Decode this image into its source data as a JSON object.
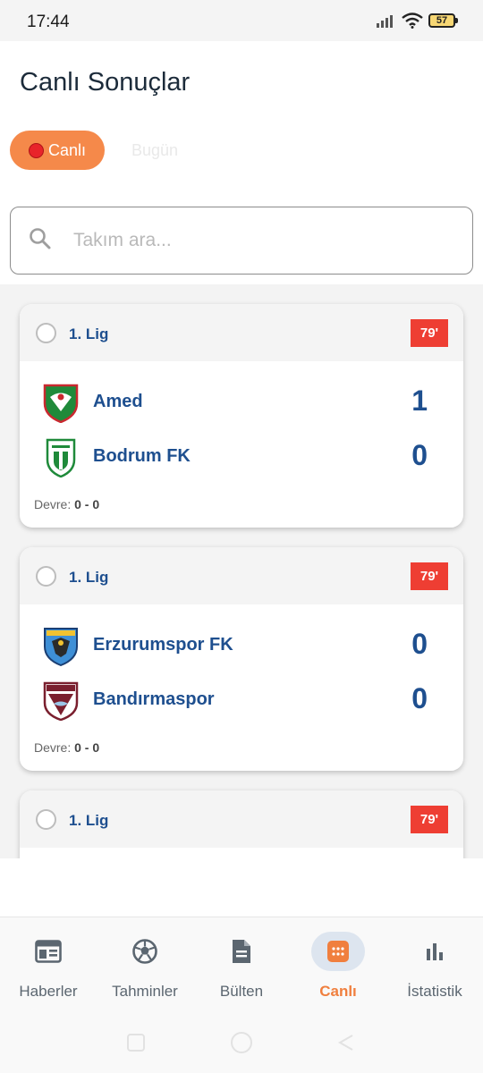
{
  "status_bar": {
    "time": "17:44",
    "battery": "57"
  },
  "page_title": "Canlı Sonuçlar",
  "tabs": [
    {
      "label": "Canlı",
      "active": true
    },
    {
      "label": "Bugün",
      "active": false
    }
  ],
  "search": {
    "placeholder": "Takım ara...",
    "value": ""
  },
  "matches": [
    {
      "league": "1. Lig",
      "minute": "79'",
      "home": {
        "name": "Amed",
        "score": "1"
      },
      "away": {
        "name": "Bodrum FK",
        "score": "0"
      },
      "halftime_label": "Devre:",
      "halftime_score": "0 - 0"
    },
    {
      "league": "1. Lig",
      "minute": "79'",
      "home": {
        "name": "Erzurumspor FK",
        "score": "0"
      },
      "away": {
        "name": "Bandırmaspor",
        "score": "0"
      },
      "halftime_label": "Devre:",
      "halftime_score": "0 - 0"
    },
    {
      "league": "1. Lig",
      "minute": "79'"
    }
  ],
  "bottom_nav": [
    {
      "label": "Haberler",
      "icon": "news-icon",
      "active": false
    },
    {
      "label": "Tahminler",
      "icon": "soccer-ball-icon",
      "active": false
    },
    {
      "label": "Bülten",
      "icon": "document-icon",
      "active": false
    },
    {
      "label": "Canlı",
      "icon": "live-grid-icon",
      "active": true
    },
    {
      "label": "İstatistik",
      "icon": "bar-chart-icon",
      "active": false
    }
  ],
  "colors": {
    "accent": "#f5894a",
    "primary_text": "#1e4f8f",
    "live_badge": "#ee3e33",
    "active_nav_label": "#f07f3e"
  }
}
